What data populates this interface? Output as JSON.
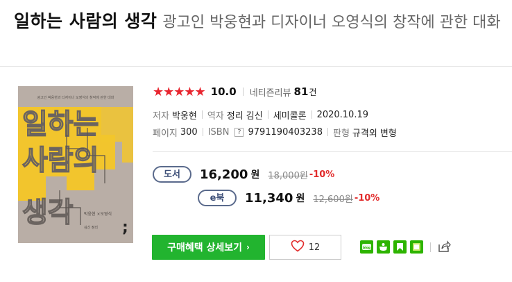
{
  "title": {
    "main": "일하는 사람의 생각",
    "subtitle": "광고인 박웅현과 디자이너 오영식의 창작에 관한 대화"
  },
  "cover": {
    "big_title_lines": [
      "일하는",
      "사람의",
      "생각"
    ],
    "top_small_text": "광고인 박웅현과 디자이너 오영식의 창작에 관한 대화",
    "authors_text": "박웅현 ×오영식",
    "bottom_text": "김신 정리",
    "colors": {
      "background": "#b9aea6",
      "yellow": "#f2c52d",
      "ink": "#6b6460"
    }
  },
  "rating": {
    "stars": "★★★★★",
    "score": "10.0",
    "netizen_label": "네티즌리뷰",
    "netizen_count": "81",
    "netizen_unit": "건"
  },
  "meta": {
    "author_label": "저자",
    "author": "박웅현",
    "translator_label": "역자",
    "translator": "정리 김신",
    "publisher": "세미콜론",
    "date": "2020.10.19",
    "pages_label": "페이지",
    "pages": "300",
    "isbn_label": "ISBN",
    "isbn_help": "?",
    "isbn": "9791190403238",
    "format_label": "판형",
    "format": "규격외 변형"
  },
  "prices": {
    "book": {
      "badge": "도서",
      "price": "16,200",
      "unit": "원",
      "original": "18,000원",
      "discount": "-10%"
    },
    "ebook": {
      "badge": "e북",
      "price": "11,340",
      "unit": "원",
      "original": "12,600원",
      "discount": "-10%"
    }
  },
  "actions": {
    "buy_label": "구매혜택 상세보기",
    "buy_chevron": "›",
    "like_count": "12"
  },
  "share": {
    "icons": [
      "naver-blog-icon",
      "naver-cafe-icon",
      "naver-post-icon",
      "band-icon",
      "share-more-icon"
    ],
    "blog_text": "blog",
    "green": "#2db400"
  },
  "accent": {
    "star_red": "#e8252f",
    "buy_green": "#22b42f",
    "discount_red": "#e22c2c",
    "badge_blue": "#3d4f78"
  }
}
